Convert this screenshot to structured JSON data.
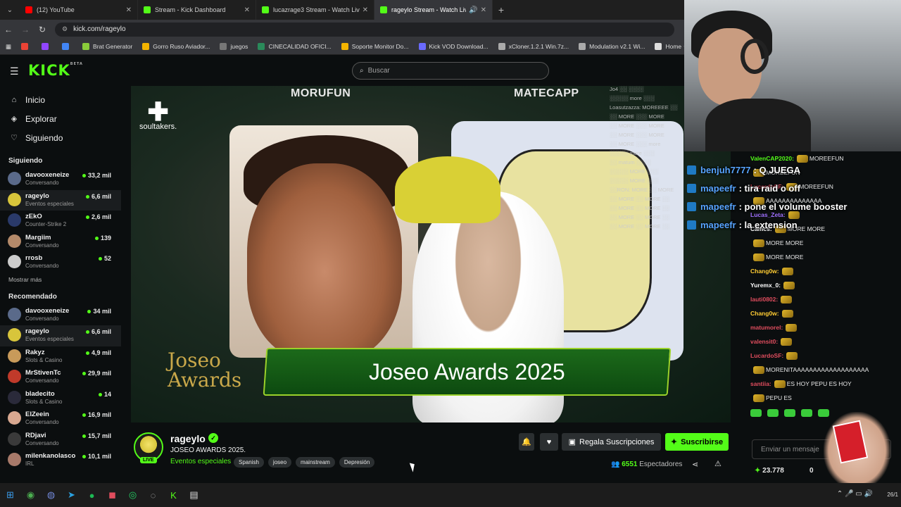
{
  "browser": {
    "tabs": [
      {
        "label": "(12) YouTube",
        "color": "#ff0000"
      },
      {
        "label": "Stream - Kick Dashboard",
        "color": "#53fc18"
      },
      {
        "label": "lucazrage3 Stream - Watch Live",
        "color": "#53fc18"
      },
      {
        "label": "rageylo Stream - Watch Live",
        "color": "#53fc18",
        "active": true
      }
    ],
    "url": "kick.com/rageylo",
    "bookmarks": [
      "Brat Generator",
      "Gorro Ruso Aviador...",
      "juegos",
      "CINECALIDAD OFICI...",
      "Soporte Monitor Do...",
      "Kick VOD Download...",
      "xCloner.1.2.1 Win.7z...",
      "Modulation v2.1 Wi...",
      "Home ✦ Satvrn"
    ]
  },
  "header": {
    "logo": "KICK",
    "logo_sup": "BETA",
    "search_placeholder": "Buscar"
  },
  "sidebar": {
    "nav": [
      {
        "label": "Inicio",
        "icon": "home-icon"
      },
      {
        "label": "Explorar",
        "icon": "compass-icon"
      },
      {
        "label": "Siguiendo",
        "icon": "heart-icon"
      }
    ],
    "following_title": "Siguiendo",
    "following": [
      {
        "name": "davooxeneize",
        "category": "Conversando",
        "viewers": "33,2 mil",
        "color": "#5a6a8a"
      },
      {
        "name": "rageylo",
        "category": "Eventos especiales",
        "viewers": "6,6 mil",
        "color": "#d8c53b",
        "selected": true
      },
      {
        "name": "zEkO",
        "category": "Counter-Strike 2",
        "viewers": "2,6 mil",
        "color": "#2a3a6a"
      },
      {
        "name": "Margiim",
        "category": "Conversando",
        "viewers": "139",
        "color": "#b48a6a"
      },
      {
        "name": "rrosb",
        "category": "Conversando",
        "viewers": "52",
        "color": "#cccccc"
      }
    ],
    "show_more": "Mostrar más",
    "recommended_title": "Recomendado",
    "recommended": [
      {
        "name": "davooxeneize",
        "category": "Conversando",
        "viewers": "34 mil",
        "color": "#5a6a8a"
      },
      {
        "name": "rageylo",
        "category": "Eventos especiales",
        "viewers": "6,6 mil",
        "color": "#d8c53b",
        "selected": true
      },
      {
        "name": "Rakyz",
        "category": "Slots & Casino",
        "viewers": "4,9 mil",
        "color": "#c89a5a"
      },
      {
        "name": "MrStivenTc",
        "category": "Conversando",
        "viewers": "29,9 mil",
        "color": "#c03a2a"
      },
      {
        "name": "bladecito",
        "category": "Slots & Casino",
        "viewers": "14",
        "color": "#2a2a3a"
      },
      {
        "name": "ElZeein",
        "category": "Conversando",
        "viewers": "16,9 mil",
        "color": "#d8a890"
      },
      {
        "name": "RDjavi",
        "category": "Conversando",
        "viewers": "15,7 mil",
        "color": "#3a3a3a"
      },
      {
        "name": "milenkanolasco",
        "category": "IRL",
        "viewers": "10,1 mil",
        "color": "#a87a6a"
      }
    ]
  },
  "video": {
    "name_left": "MORUFUN",
    "name_right": "MATECAPP",
    "brand": "soultakers.",
    "award_logo_1": "Joseo",
    "award_logo_2": "Awards",
    "banner": "Joseo Awards 2025"
  },
  "stream": {
    "channel": "rageylo",
    "live_label": "LIVE",
    "title": "JOSEO AWARDS 2025.",
    "category": "Eventos especiales",
    "tags": [
      "Spanish",
      "joseo",
      "mainstream",
      "Depresión"
    ],
    "gift_label": "Regala Suscripciones",
    "subscribe_label": "Suscribirse",
    "viewers": "6551",
    "viewers_label": "Espectadores"
  },
  "overlay_chat": [
    {
      "user": "benjuh7777",
      "msg": ": Q JUEGA"
    },
    {
      "user": "mapeefr",
      "msg": ": tira raid o off"
    },
    {
      "user": "mapeefr",
      "msg": ": pone el volume booster"
    },
    {
      "user": "mapeefr",
      "msg": ": la extension"
    }
  ],
  "chat": {
    "messages": [
      {
        "user": "ValenCAP2020:",
        "text": "MOREEFUN",
        "color": "#53fc18"
      },
      {
        "user": "",
        "text": "MOREEFUN",
        "color": "#e8e8e8"
      },
      {
        "user": "LucardoSF:",
        "text": "MOREEFUN",
        "color": "#e04d5e"
      },
      {
        "user": "",
        "text": "AAAAAAAAAAAAAA",
        "color": "#e8e8e8"
      },
      {
        "user": "Lucas_Zeta:",
        "text": "",
        "color": "#a070ff"
      },
      {
        "user": "Camcs:",
        "text": "MORE MORE",
        "color": "#ffffff"
      },
      {
        "user": "",
        "text": "MORE MORE",
        "color": "#e8e8e8"
      },
      {
        "user": "",
        "text": "MORE MORE",
        "color": "#e8e8e8"
      },
      {
        "user": "Chang0w:",
        "text": "",
        "color": "#ffcc33"
      },
      {
        "user": "Yuremx_0:",
        "text": "",
        "color": "#ffffff"
      },
      {
        "user": "lauti0802:",
        "text": "",
        "color": "#e04d5e"
      },
      {
        "user": "Chang0w:",
        "text": "",
        "color": "#ffcc33"
      },
      {
        "user": "matumorel:",
        "text": "",
        "color": "#e04d5e"
      },
      {
        "user": "valensit0:",
        "text": "",
        "color": "#e04d5e"
      },
      {
        "user": "LucardoSF:",
        "text": "",
        "color": "#e04d5e"
      },
      {
        "user": "",
        "text": "MORENITAAAAAAAAAAAAAAAAAAA",
        "color": "#e8e8e8"
      },
      {
        "user": "santiia:",
        "text": "ES HOY PEPU ES HOY",
        "color": "#e04d5e"
      },
      {
        "user": "",
        "text": "PEPU ES",
        "color": "#e8e8e8"
      }
    ],
    "input_placeholder": "Enviar un mensaje",
    "points": "23.778",
    "zero": "0"
  },
  "taskbar": {
    "date": "26/1"
  }
}
